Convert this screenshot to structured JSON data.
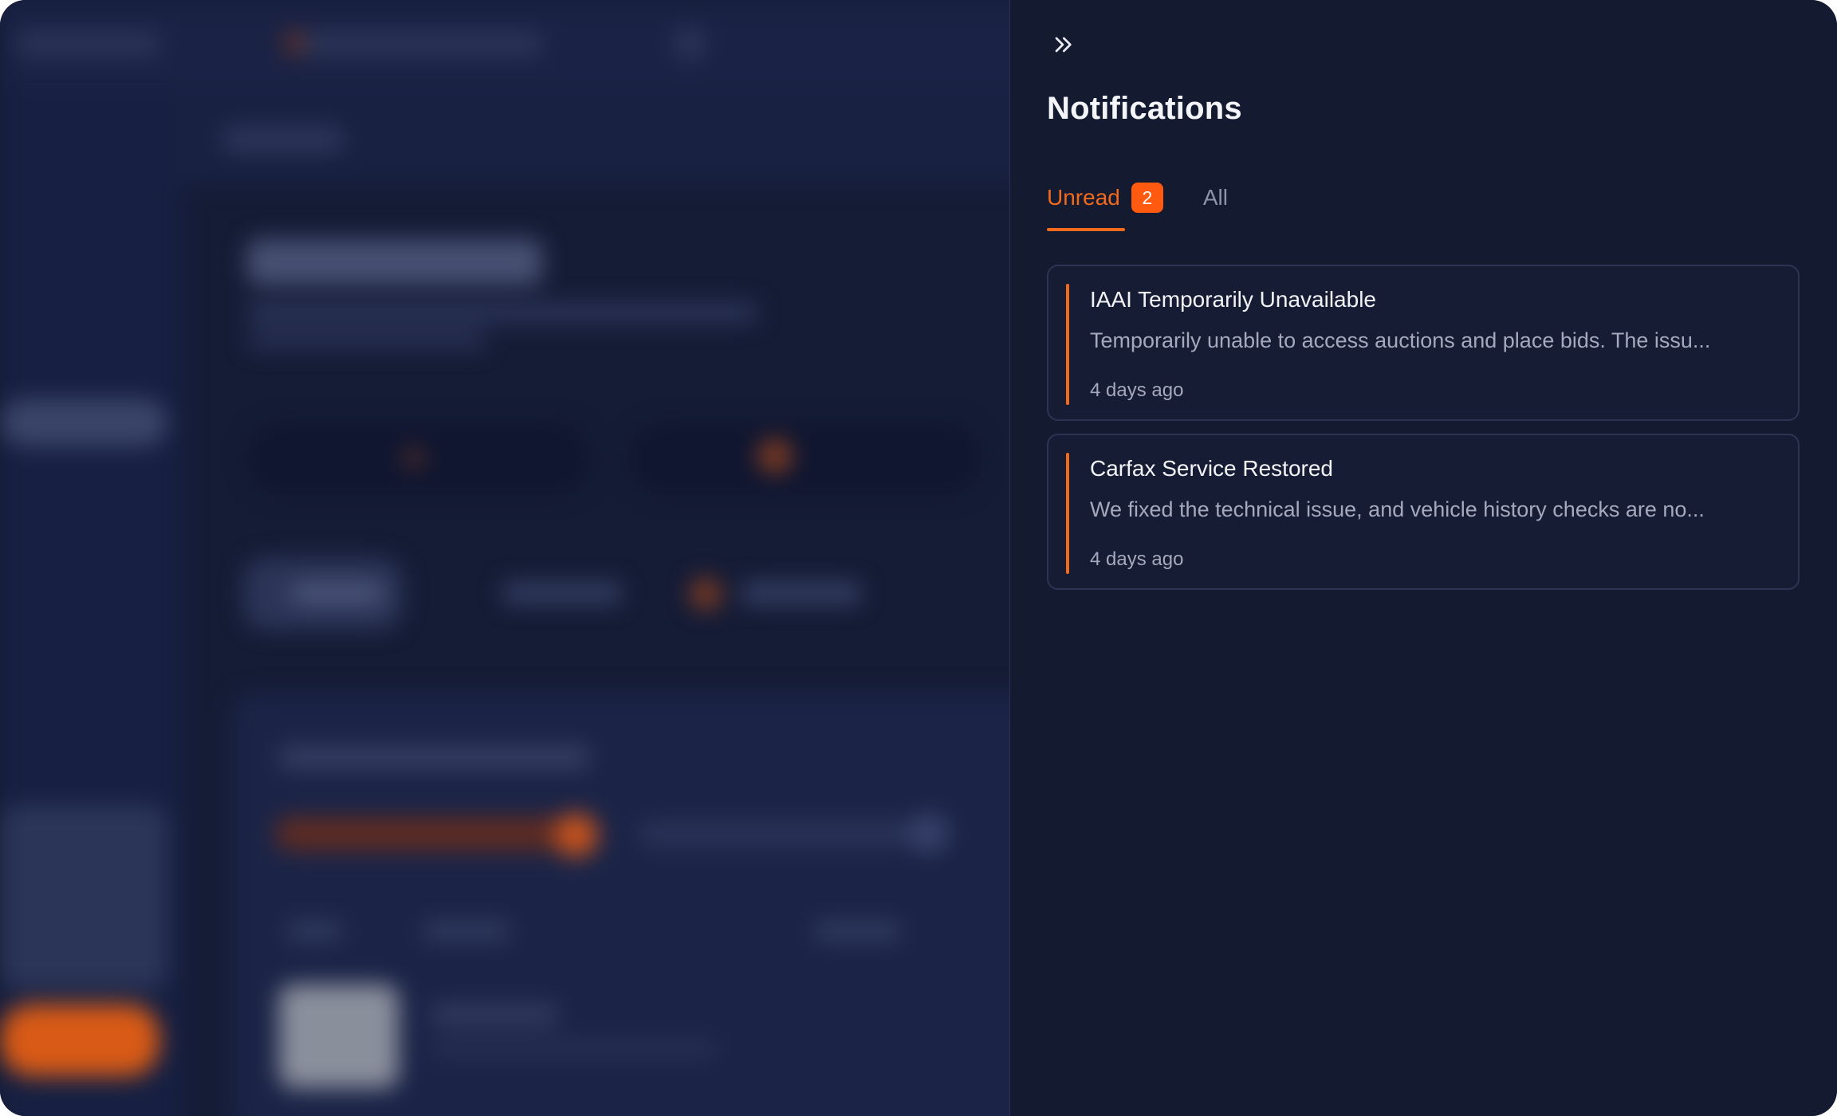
{
  "panel": {
    "title": "Notifications",
    "collapse_icon": "chevrons-right-icon"
  },
  "tabs": {
    "unread": {
      "label": "Unread",
      "count": "2"
    },
    "all": {
      "label": "All"
    },
    "active": "unread"
  },
  "notifications": [
    {
      "title": "IAAI Temporarily Unavailable",
      "body": "Temporarily unable to access auctions and place bids. The issu...",
      "time": "4 days ago"
    },
    {
      "title": "Carfax Service Restored",
      "body": "We fixed the technical issue, and vehicle history checks are no...",
      "time": "4 days ago"
    }
  ],
  "colors": {
    "accent": "#f26a1b",
    "badge": "#ff5a0f",
    "panel_bg": "#141a30",
    "text_primary": "#f2f3f7",
    "text_secondary": "#a4a9bd",
    "tab_inactive": "#8d93a8"
  }
}
